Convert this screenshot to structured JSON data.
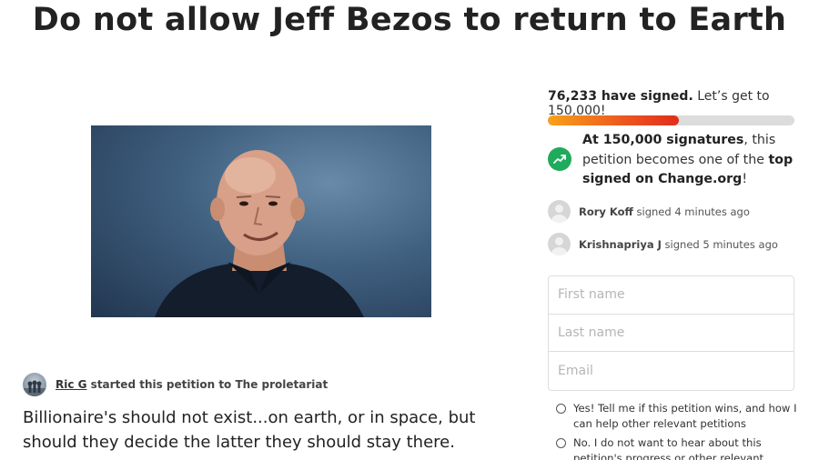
{
  "page": {
    "title": "Do not allow Jeff Bezos to return to Earth"
  },
  "hero_image": {
    "description_icon": "bald-man-photo"
  },
  "starter": {
    "name": "Ric G",
    "text": " started this petition to The proletariat"
  },
  "description": "Billionaire's should not exist...on earth, or in space, but should they decide the latter they should stay there.",
  "signatures": {
    "count_text": "76,233 have signed.",
    "goal_text": " Let’s get to 150,000!",
    "progress_fraction": 0.53
  },
  "milestone": {
    "bold1": "At 150,000 signatures",
    "text1": ", this petition becomes one of the ",
    "bold2": "top signed on Change.org",
    "text2": "!",
    "icon": "trending-up-icon",
    "icon_color": "#1faa5c"
  },
  "recent_signers": [
    {
      "name": "Rory Koff",
      "action": " signed 4 minutes ago"
    },
    {
      "name": "Krishnapriya J",
      "action": " signed 5 minutes ago"
    }
  ],
  "form": {
    "first_name_placeholder": "First name",
    "last_name_placeholder": "Last name",
    "email_placeholder": "Email"
  },
  "options": {
    "yes_label": "Yes! Tell me if this petition wins, and how I can help other relevant petitions",
    "no_label": "No. I do not want to hear about this petition's progress or other relevant petitions"
  },
  "colors": {
    "progress_start": "#f7a21a",
    "progress_end": "#e02d1c",
    "progress_track": "#dcdcdc"
  }
}
